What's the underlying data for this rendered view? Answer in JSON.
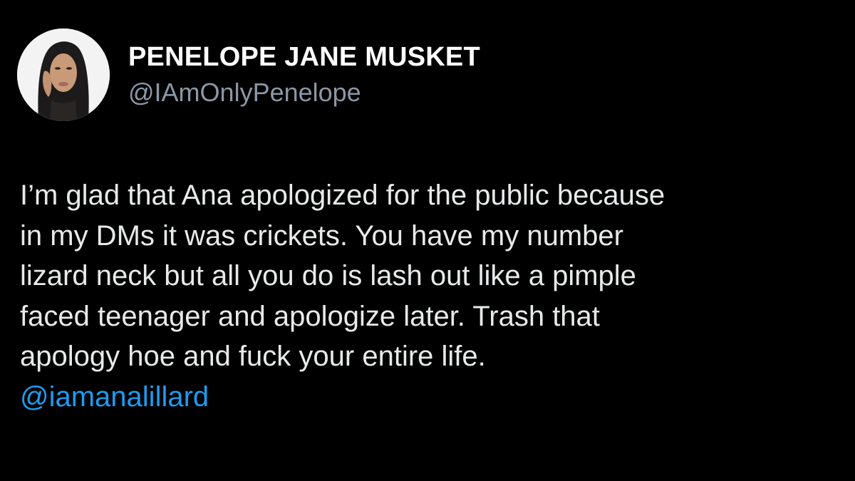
{
  "tweet": {
    "author": {
      "display_name": "PENELOPE JANE MUSKET",
      "handle": "@IAmOnlyPenelope",
      "avatar_icon": "profile-photo-avatar"
    },
    "body_lines": [
      "I’m glad that Ana apologized for the public because",
      "in my DMs it was crickets. You have my number",
      "lizard neck but all you do is lash out like a pimple",
      "faced teenager and apologize later. Trash that",
      "apology hoe and fuck your entire life."
    ],
    "mention": "@iamanalillard"
  },
  "colors": {
    "background": "#000000",
    "primary_text": "#e7e9ea",
    "display_name": "#ffffff",
    "secondary_text": "#8b98a5",
    "link": "#1d9bf0"
  }
}
